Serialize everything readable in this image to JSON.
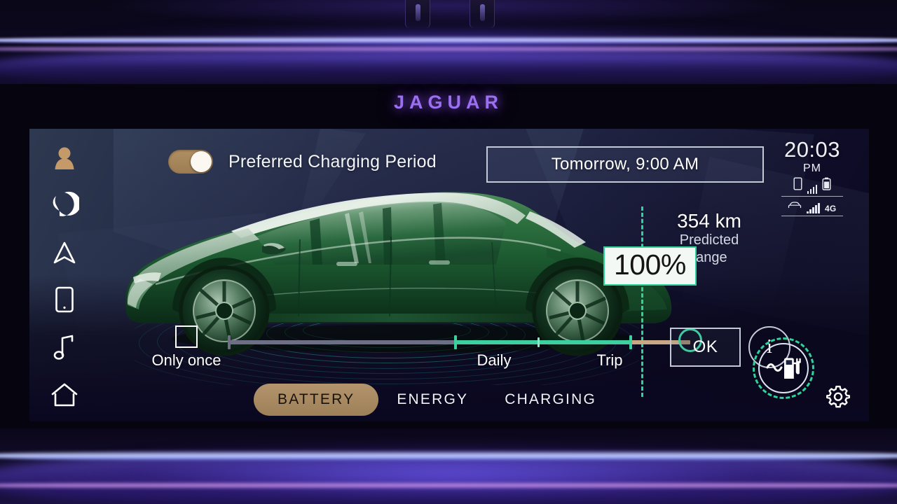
{
  "brand": {
    "name": "JAGUAR"
  },
  "sidebar": {
    "items": [
      {
        "name": "profile",
        "icon": "user-icon",
        "label": "Profile"
      },
      {
        "name": "voice",
        "icon": "voice-assistant-icon",
        "label": "Voice Assistant"
      },
      {
        "name": "navigation",
        "icon": "navigation-arrow-icon",
        "label": "Navigation"
      },
      {
        "name": "phone",
        "icon": "phone-icon",
        "label": "Phone"
      },
      {
        "name": "media",
        "icon": "music-note-icon",
        "label": "Media"
      },
      {
        "name": "home",
        "icon": "home-icon",
        "label": "Home"
      }
    ]
  },
  "header": {
    "toggle_label": "Preferred Charging Period",
    "toggle_state": "on",
    "schedule_value": "Tomorrow, 9:00 AM"
  },
  "status": {
    "time": "20:03",
    "meridiem": "PM",
    "phone_icon": "phone-device-icon",
    "phone_signal_bars": 4,
    "battery_icon": "battery-icon",
    "car_icon": "car-icon",
    "car_signal_bars": 5,
    "network": "4G"
  },
  "battery": {
    "percent_label": "100%",
    "range_value": "354 km",
    "range_label_line1": "Predicted",
    "range_label_line2": "range",
    "charge_icon": "ac-charging-station-icon"
  },
  "slider": {
    "checkbox_label": "Only once",
    "checkbox_checked": false,
    "tick_labels": {
      "daily": "Daily",
      "trip": "Trip"
    },
    "ok_label": "OK",
    "info_label": "i"
  },
  "tabs": [
    {
      "label": "BATTERY",
      "active": true
    },
    {
      "label": "ENERGY",
      "active": false
    },
    {
      "label": "CHARGING",
      "active": false
    }
  ],
  "footer": {
    "settings_icon": "gear-icon"
  },
  "colors": {
    "accent_gold": "#b3946c",
    "accent_green": "#3ecfa0",
    "brand_purple": "#9a6ff0",
    "text_primary": "#ffffff"
  }
}
